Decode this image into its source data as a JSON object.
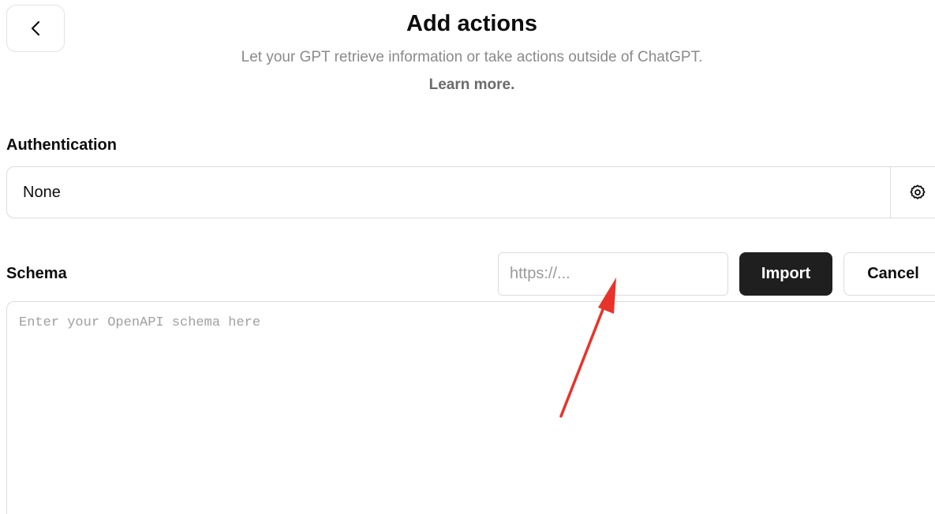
{
  "header": {
    "title": "Add actions",
    "subtitle": "Let your GPT retrieve information or take actions outside of ChatGPT.",
    "learn_more": "Learn more.",
    "back_icon": "chevron-left-icon"
  },
  "authentication": {
    "label": "Authentication",
    "value": "None",
    "settings_icon": "gear-icon"
  },
  "schema": {
    "label": "Schema",
    "url_placeholder": "https://...",
    "url_value": "",
    "import_label": "Import",
    "cancel_label": "Cancel",
    "textarea_placeholder": "Enter your OpenAPI schema here"
  },
  "annotation": {
    "arrow_color": "#e8332a",
    "arrow_icon": "red-arrow-annotation"
  },
  "colors": {
    "primary_button": "#1f1f1f",
    "border": "#dcdcdc",
    "muted_text": "#8a8a8a"
  }
}
